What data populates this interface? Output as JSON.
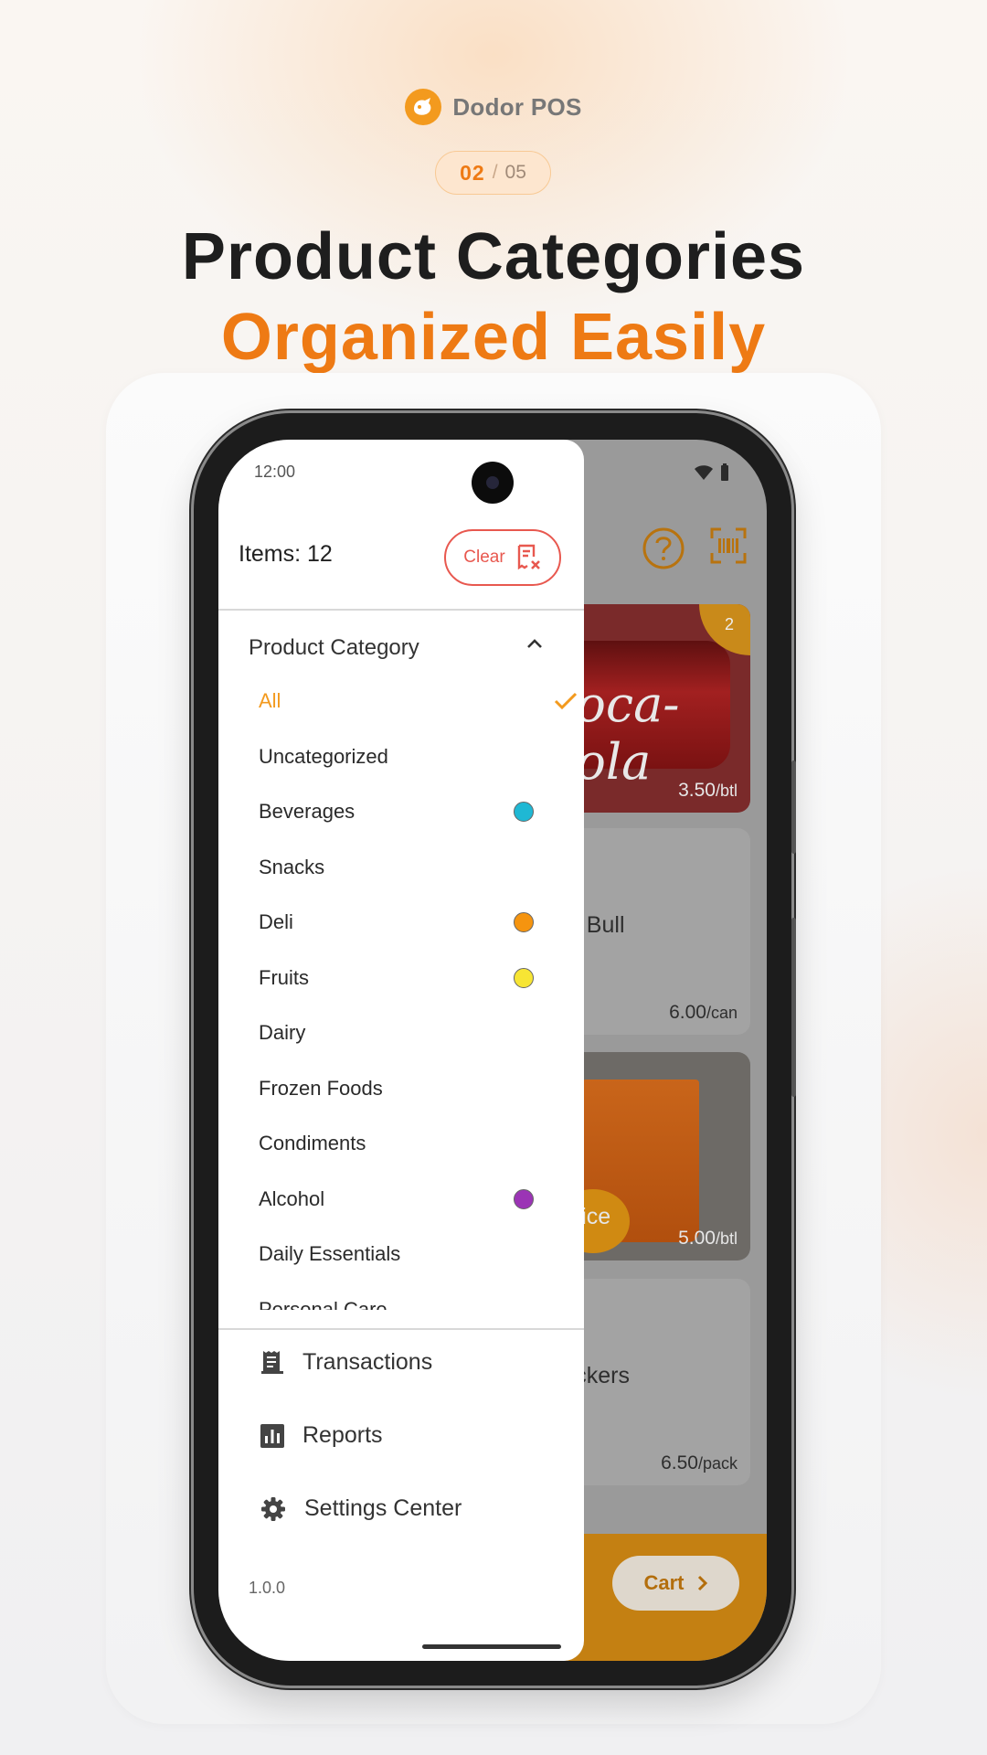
{
  "header": {
    "brand_name": "Dodor POS",
    "step_current": "02",
    "step_separator": "/",
    "step_total": "05",
    "title_line1": "Product Categories",
    "title_line2": "Organized Easily"
  },
  "status_bar": {
    "time": "12:00"
  },
  "drawer": {
    "items_label": "Items: 12",
    "clear_label": "Clear",
    "category_header": "Product Category",
    "categories": [
      {
        "label": "All",
        "selected": true,
        "color": null
      },
      {
        "label": "Uncategorized",
        "selected": false,
        "color": null
      },
      {
        "label": "Beverages",
        "selected": false,
        "color": "#1fb8d4"
      },
      {
        "label": "Snacks",
        "selected": false,
        "color": null
      },
      {
        "label": "Deli",
        "selected": false,
        "color": "#f5940f"
      },
      {
        "label": "Fruits",
        "selected": false,
        "color": "#f7e534"
      },
      {
        "label": "Dairy",
        "selected": false,
        "color": null
      },
      {
        "label": "Frozen Foods",
        "selected": false,
        "color": null
      },
      {
        "label": "Condiments",
        "selected": false,
        "color": null
      },
      {
        "label": "Alcohol",
        "selected": false,
        "color": "#9b34b5"
      },
      {
        "label": "Daily Essentials",
        "selected": false,
        "color": null
      },
      {
        "label": "Personal Care",
        "selected": false,
        "color": null
      }
    ],
    "menu": [
      {
        "label": "Transactions",
        "icon": "receipt-icon"
      },
      {
        "label": "Reports",
        "icon": "bar-chart-icon"
      },
      {
        "label": "Settings Center",
        "icon": "gear-icon"
      }
    ],
    "version": "1.0.0"
  },
  "products": [
    {
      "name": "Coca-Cola",
      "badge": "2",
      "price": "3.50",
      "unit": "/btl"
    },
    {
      "name": "Red Bull",
      "price": "6.00",
      "unit": "/can"
    },
    {
      "name": "e Juice",
      "price": "5.00",
      "unit": "/btl"
    },
    {
      "name": "Crackers",
      "price": "6.50",
      "unit": "/pack"
    }
  ],
  "cart": {
    "label": "Cart"
  },
  "colors": {
    "accent": "#ee7a14",
    "accent_light": "#f39a1e",
    "danger": "#e8584f",
    "title_dark": "#1e1e1e"
  }
}
